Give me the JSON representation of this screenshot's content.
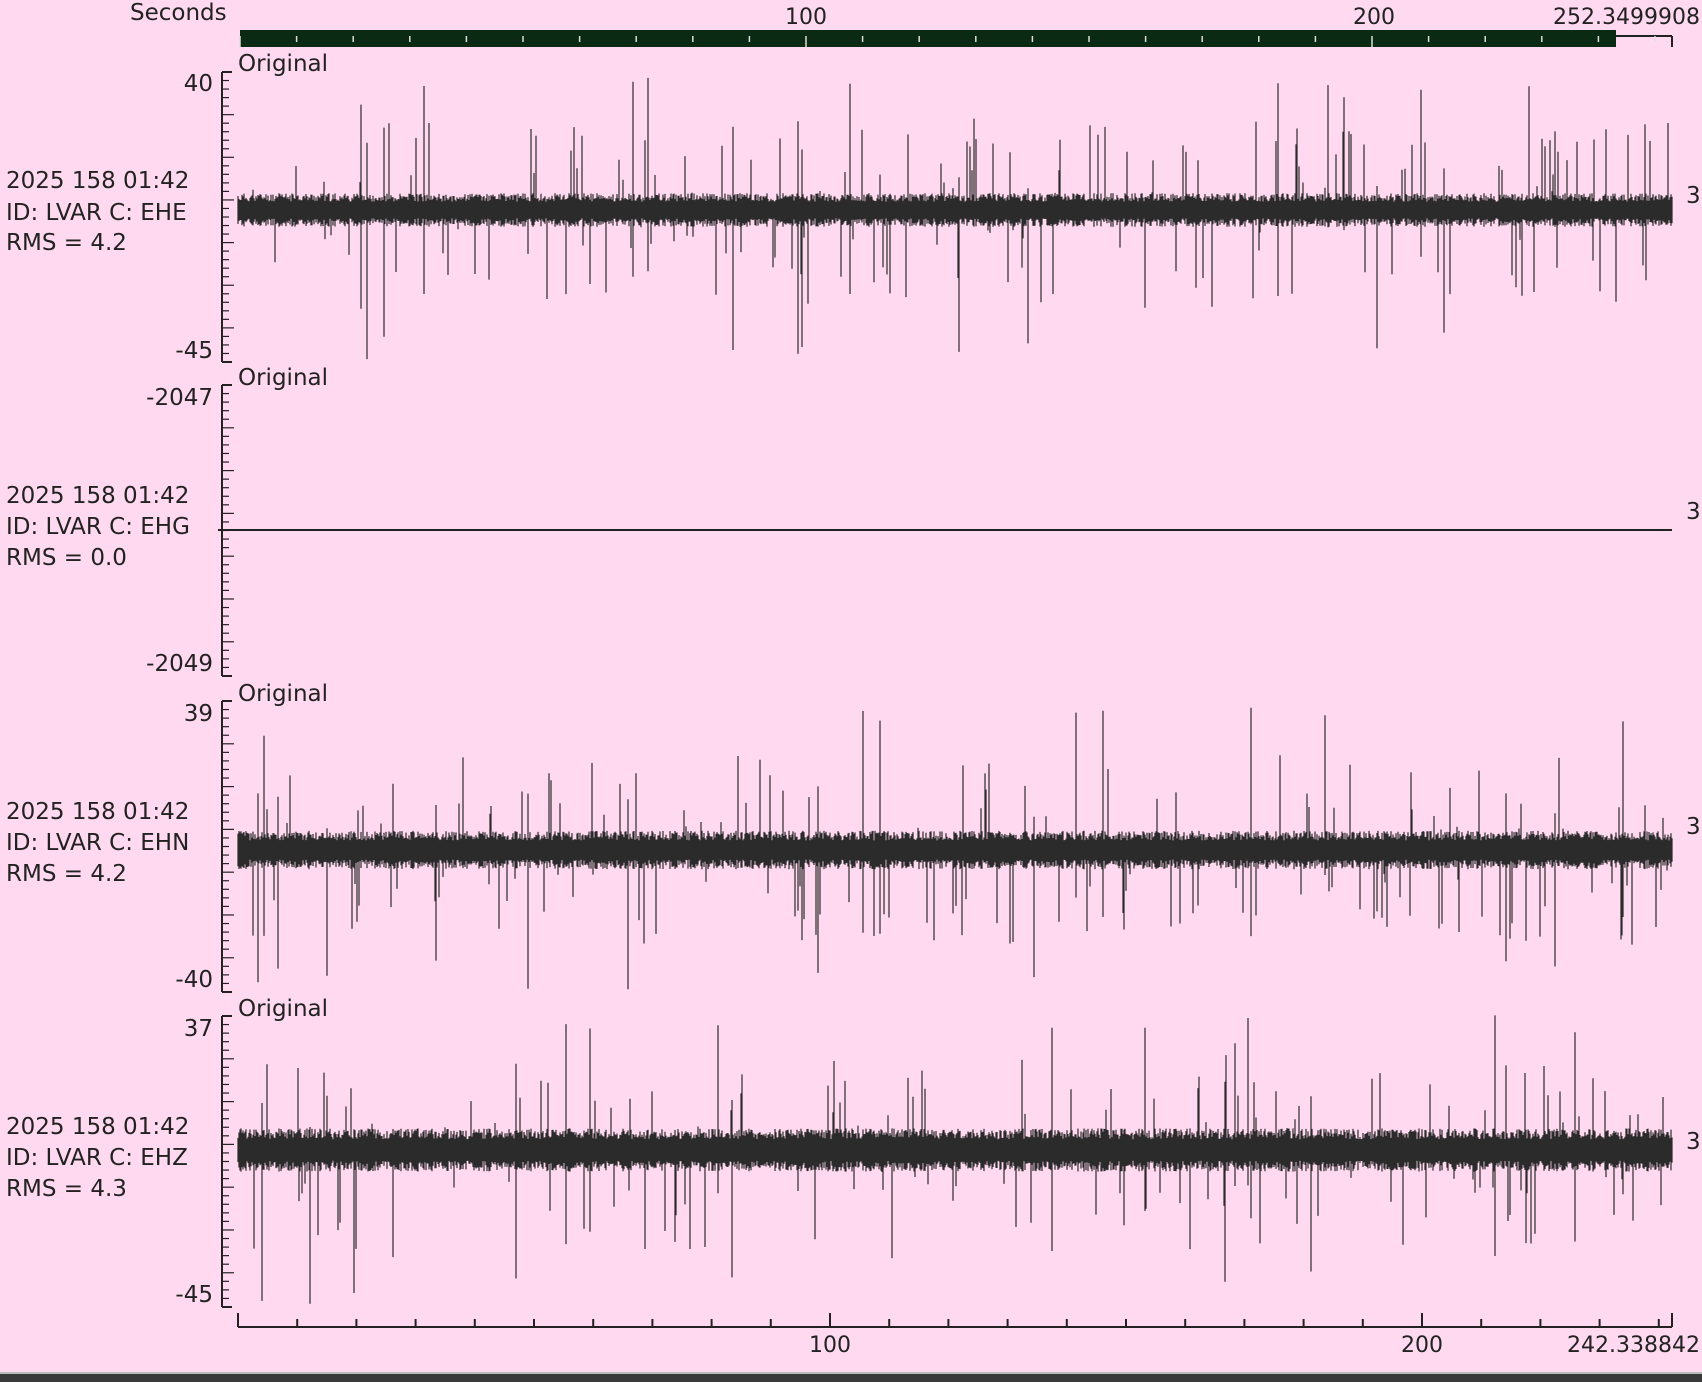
{
  "window": {
    "background": "#ffd9f0",
    "trace_color": "#2b2b2b",
    "top_bar_color": "#0a2a14"
  },
  "top_axis": {
    "label": "Seconds",
    "ticks": [
      "100",
      "200"
    ],
    "end_label": "252.3499908"
  },
  "bottom_axis": {
    "ticks": [
      "100",
      "200"
    ],
    "end_label": "242.338842"
  },
  "traces": [
    {
      "header": "Original",
      "time": "2025 158 01:42",
      "id": "ID: LVAR C: EHE",
      "rms": "RMS = 4.2",
      "y_max": "40",
      "y_min": "-45",
      "right_label": "3",
      "flat": false
    },
    {
      "header": "Original",
      "time": "2025 158 01:42",
      "id": "ID: LVAR C: EHG",
      "rms": "RMS = 0.0",
      "y_max": "-2047",
      "y_min": "-2049",
      "right_label": "3",
      "flat": true
    },
    {
      "header": "Original",
      "time": "2025 158 01:42",
      "id": "ID: LVAR C: EHN",
      "rms": "RMS = 4.2",
      "y_max": "39",
      "y_min": "-40",
      "right_label": "3",
      "flat": false
    },
    {
      "header": "Original",
      "time": "2025 158 01:42",
      "id": "ID: LVAR C: EHZ",
      "rms": "RMS = 4.3",
      "y_max": "37",
      "y_min": "-45",
      "right_label": "3",
      "flat": false
    }
  ]
}
